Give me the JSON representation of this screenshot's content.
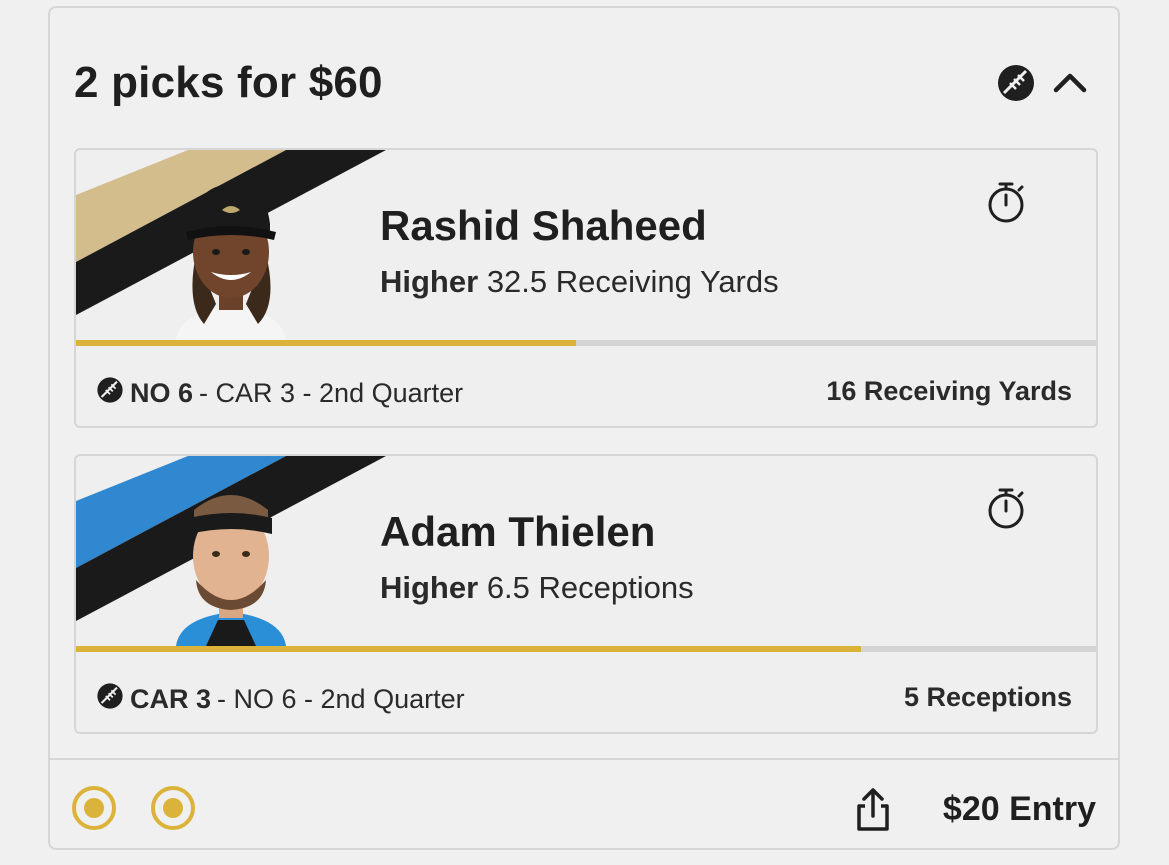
{
  "header": {
    "title": "2 picks for $60",
    "sport_icon": "football-icon",
    "collapse_icon": "chevron-up-icon"
  },
  "picks": [
    {
      "player_name": "Rashid Shaheed",
      "direction": "Higher",
      "line": "32.5 Receiving Yards",
      "team_colors": [
        "#d3bd8d",
        "#1a1a1a"
      ],
      "progress": 0.49,
      "game": {
        "team": "NO 6",
        "rest": "- CAR 3 - 2nd Quarter"
      },
      "current_stat": "16 Receiving Yards",
      "timer_icon": "stopwatch-icon"
    },
    {
      "player_name": "Adam Thielen",
      "direction": "Higher",
      "line": "6.5 Receptions",
      "team_colors": [
        "#2f88d0",
        "#1a1a1a"
      ],
      "progress": 0.77,
      "game": {
        "team": "CAR 3",
        "rest": "- NO 6 - 2nd Quarter"
      },
      "current_stat": "5 Receptions",
      "timer_icon": "stopwatch-icon"
    }
  ],
  "footer": {
    "share_icon": "share-icon",
    "entry": "$20 Entry",
    "status_color": "#dcb33a"
  }
}
